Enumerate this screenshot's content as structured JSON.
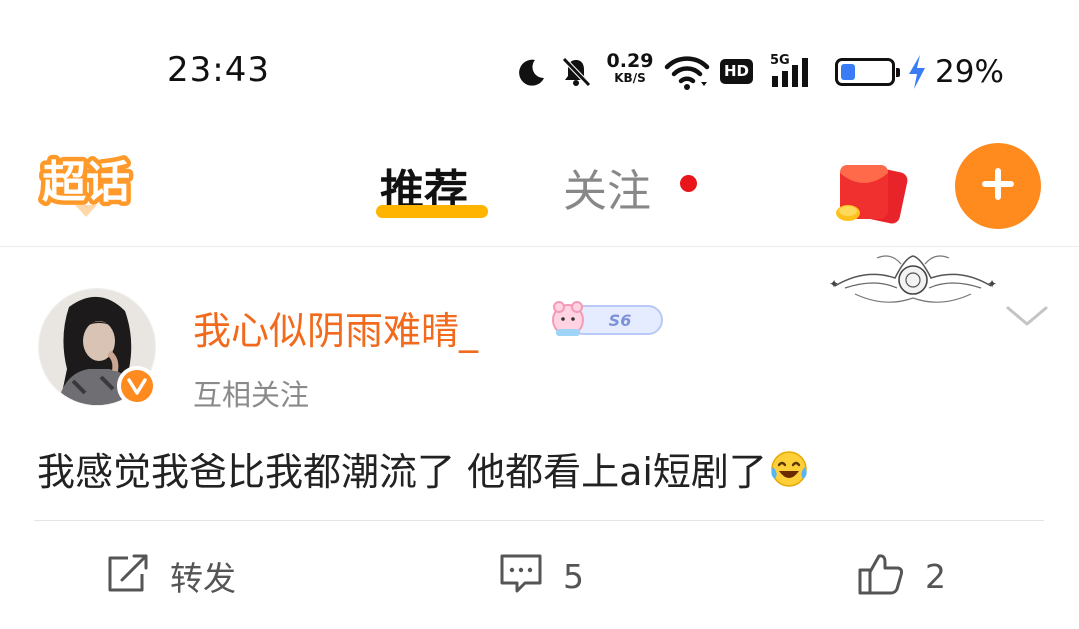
{
  "status_bar": {
    "time": "23:43",
    "net_speed_value": "0.29",
    "net_speed_unit": "KB/S",
    "hd_label": "HD",
    "network_label": "5G",
    "battery_percent": "29%",
    "battery_level": 0.29,
    "icons": [
      "moon-icon",
      "bell-muted-icon",
      "wifi-icon",
      "signal-icon",
      "battery-icon",
      "charging-icon"
    ]
  },
  "top_nav": {
    "logo_text": "超话",
    "tabs": [
      {
        "label": "推荐",
        "active": true
      },
      {
        "label": "关注",
        "active": false,
        "has_dot": true
      }
    ],
    "icons": [
      "red-packet-icon",
      "plus-icon"
    ],
    "accent_color": "#ff8a1e",
    "underline_color": "#ffb400"
  },
  "post": {
    "username": "我心似阴雨难晴_",
    "level_badge": "S6",
    "relation": "互相关注",
    "text": "我感觉我爸比我都潮流了 他都看上ai短剧了",
    "emoji_icon": "laughing-tears-emoji-icon",
    "actions": {
      "repost_label": "转发",
      "comment_count": "5",
      "like_count": "2"
    },
    "username_color": "#f26b1d"
  }
}
